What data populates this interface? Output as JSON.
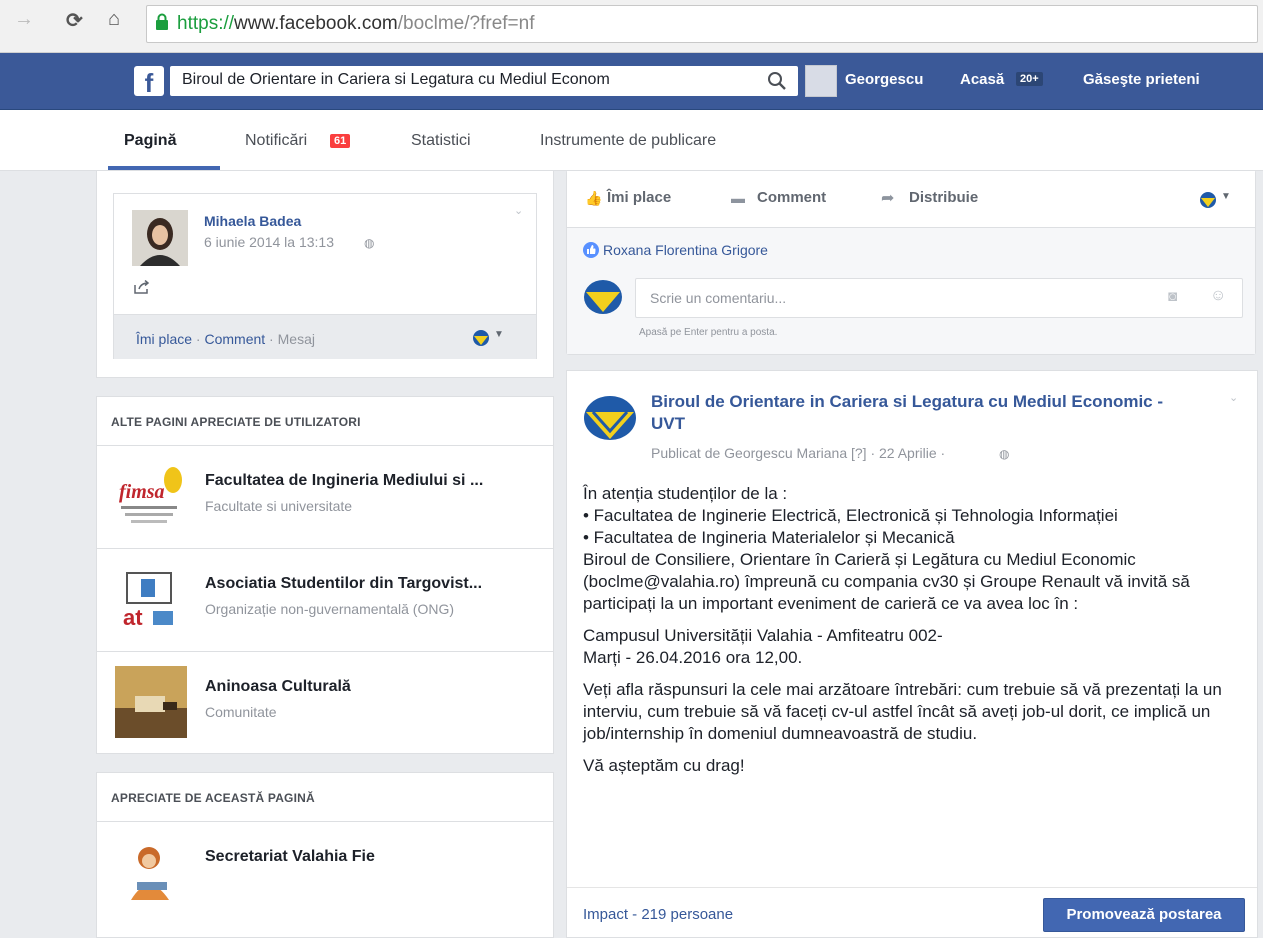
{
  "browser": {
    "url_scheme": "https://",
    "url_host": "www.facebook.com",
    "url_path": "/boclme/?fref=nf"
  },
  "topbar": {
    "logo": "f",
    "search_value": "Biroul de Orientare in Cariera si Legatura cu Mediul Econom",
    "user_name": "Georgescu",
    "home_label": "Acasă",
    "home_badge": "20+",
    "find_friends": "Găseşte prieteni"
  },
  "page_tabs": {
    "page": "Pagină",
    "notifications": "Notificări",
    "notifications_count": "61",
    "stats": "Statistici",
    "tools": "Instrumente de publicare"
  },
  "left": {
    "comment": {
      "name": "Mihaela Badea",
      "date": "6 iunie 2014 la 13:13",
      "action_like": "Îmi place",
      "sep": " · ",
      "action_comment": "Comment",
      "action_message": "Mesaj"
    },
    "liked_by_users": {
      "title": "ALTE PAGINI APRECIATE DE UTILIZATORI",
      "items": [
        {
          "name": "Facultatea de Ingineria Mediului si ...",
          "sub": "Facultate si universitate",
          "thumb": "fimsa"
        },
        {
          "name": "Asociatia Studentilor din Targovist...",
          "sub": "Organizație non-guvernamentală (ONG)",
          "thumb": "at"
        },
        {
          "name": "Aninoasa Culturală",
          "sub": "Comunitate",
          "thumb": ""
        }
      ]
    },
    "liked_by_page": {
      "title": "APRECIATE DE ACEASTĂ PAGINĂ",
      "items": [
        {
          "name": "Secretariat Valahia Fie"
        }
      ]
    }
  },
  "right": {
    "actions": {
      "like": "Îmi place",
      "comment": "Comment",
      "share": "Distribuie"
    },
    "liker": "Roxana Florentina Grigore",
    "comment_placeholder": "Scrie un comentariu...",
    "enter_hint": "Apasă pe Enter pentru a posta.",
    "post": {
      "title": "Biroul de Orientare in Cariera si Legatura cu Mediul Economic - UVT",
      "meta": "Publicat de Georgescu Mariana [?] · 22 Aprilie ·",
      "p1": "În atenția studenților de la :",
      "p2": "• Facultatea de Inginerie Electrică, Electronică și Tehnologia Informației",
      "p3": "• Facultatea de Ingineria Materialelor și Mecanică",
      "p4": "Biroul de Consiliere, Orientare în Carieră și Legătura cu Mediul Economic (boclme@valahia.ro) împreună cu compania cv30 și Groupe Renault vă invită să participați la un important eveniment de carieră ce va avea loc în :",
      "p5a": "Campusul Universității Valahia - Amfiteatru 002-",
      "p5b": "Marți - 26.04.2016 ora 12,00.",
      "p6": "Veți afla răspunsuri la cele mai arzătoare întrebări: cum trebuie să vă prezentați la un interviu, cum trebuie să vă faceți cv-ul astfel încât să aveți job-ul dorit, ce implică un job/internship în domeniul dumneavoastră de studiu.",
      "p7": "Vă așteptăm cu drag!",
      "impact": "Impact - 219 persoane",
      "promote": "Promovează postarea"
    }
  },
  "colors": {
    "fb_blue": "#3b5998",
    "link": "#365899",
    "button": "#4267b2",
    "badge_red": "#fa3e3e"
  }
}
